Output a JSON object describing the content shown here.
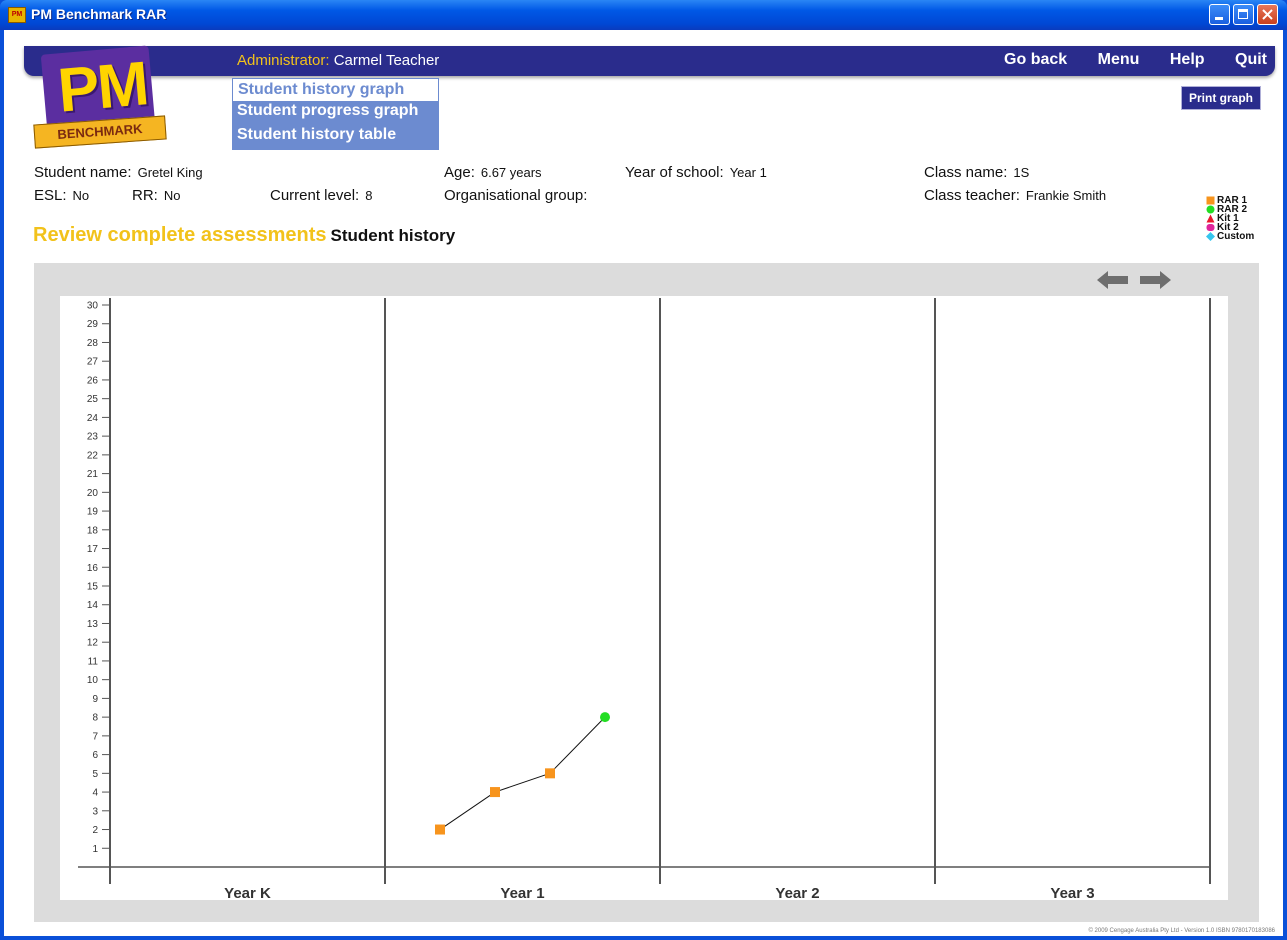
{
  "window": {
    "title": "PM Benchmark RAR",
    "icon_label": "PM"
  },
  "header": {
    "admin_label": "Administrator:",
    "admin_name": "Carmel Teacher",
    "nav": [
      "Go back",
      "Menu",
      "Help",
      "Quit"
    ],
    "print_button": "Print graph"
  },
  "logo": {
    "pm": "PM",
    "benchmark": "BENCHMARK"
  },
  "menu": {
    "items": [
      "Student history graph",
      "Student progress graph",
      "Student history table"
    ],
    "selected": "Student history graph"
  },
  "student": {
    "name_label": "Student name:",
    "name": "Gretel King",
    "age_label": "Age:",
    "age": "6.67 years",
    "year_label": "Year of school:",
    "year": "Year 1",
    "class_label": "Class name:",
    "class": "1S",
    "esl_label": "ESL:",
    "esl": "No",
    "rr_label": "RR:",
    "rr": "No",
    "level_label": "Current level:",
    "level": "8",
    "group_label": "Organisational group:",
    "group": "",
    "teacher_label": "Class teacher:",
    "teacher": "Frankie Smith"
  },
  "section": {
    "title": "Review complete assessments",
    "subtitle": "Student history"
  },
  "legend": [
    {
      "label": "RAR 1",
      "color": "#f7941d",
      "shape": "square"
    },
    {
      "label": "RAR 2",
      "color": "#22dd22",
      "shape": "circle"
    },
    {
      "label": "Kit 1",
      "color": "#e8192c",
      "shape": "triangle"
    },
    {
      "label": "Kit 2",
      "color": "#e0249a",
      "shape": "rounded"
    },
    {
      "label": "Custom",
      "color": "#35c6ee",
      "shape": "diamond"
    }
  ],
  "chart_data": {
    "type": "line",
    "categories": [
      "Year K",
      "Year 1",
      "Year 2",
      "Year 3"
    ],
    "ylim": [
      0,
      30
    ],
    "yticks": [
      1,
      2,
      3,
      4,
      5,
      6,
      7,
      8,
      9,
      10,
      11,
      12,
      13,
      14,
      15,
      16,
      17,
      18,
      19,
      20,
      21,
      22,
      23,
      24,
      25,
      26,
      27,
      28,
      29,
      30
    ],
    "points": [
      {
        "category": "Year 1",
        "position": 0.2,
        "value": 2,
        "series": "RAR 1"
      },
      {
        "category": "Year 1",
        "position": 0.4,
        "value": 4,
        "series": "RAR 1"
      },
      {
        "category": "Year 1",
        "position": 0.6,
        "value": 5,
        "series": "RAR 1"
      },
      {
        "category": "Year 1",
        "position": 0.8,
        "value": 8,
        "series": "RAR 2"
      }
    ]
  },
  "footer": {
    "copyright": "© 2009 Cengage Australia Pty Ltd - Version 1.0 ISBN 9780170183086"
  }
}
